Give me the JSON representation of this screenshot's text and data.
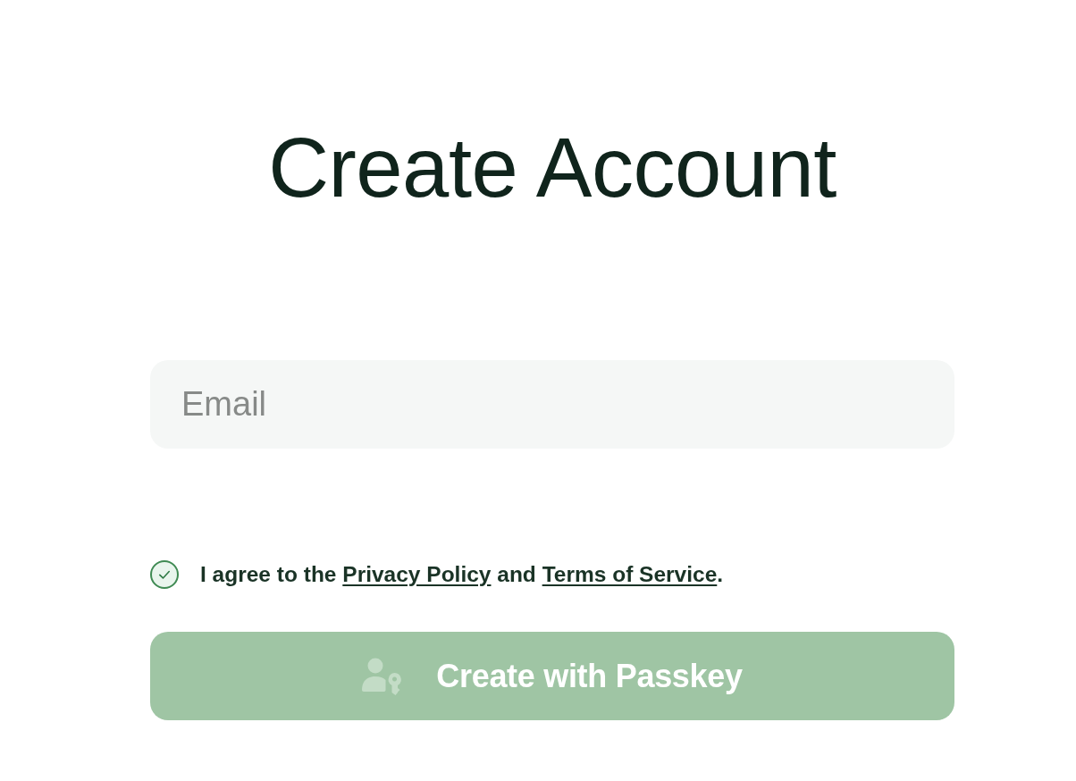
{
  "title": "Create Account",
  "email_field": {
    "placeholder": "Email"
  },
  "agreement": {
    "checked": true,
    "parts": [
      {
        "kind": "text",
        "text": "I agree to the "
      },
      {
        "kind": "link",
        "text": "Privacy Policy"
      },
      {
        "kind": "text",
        "text": " and "
      },
      {
        "kind": "link",
        "text": "Terms of Service"
      },
      {
        "kind": "text",
        "text": "."
      }
    ]
  },
  "submit_button": {
    "label": "Create with Passkey"
  }
}
